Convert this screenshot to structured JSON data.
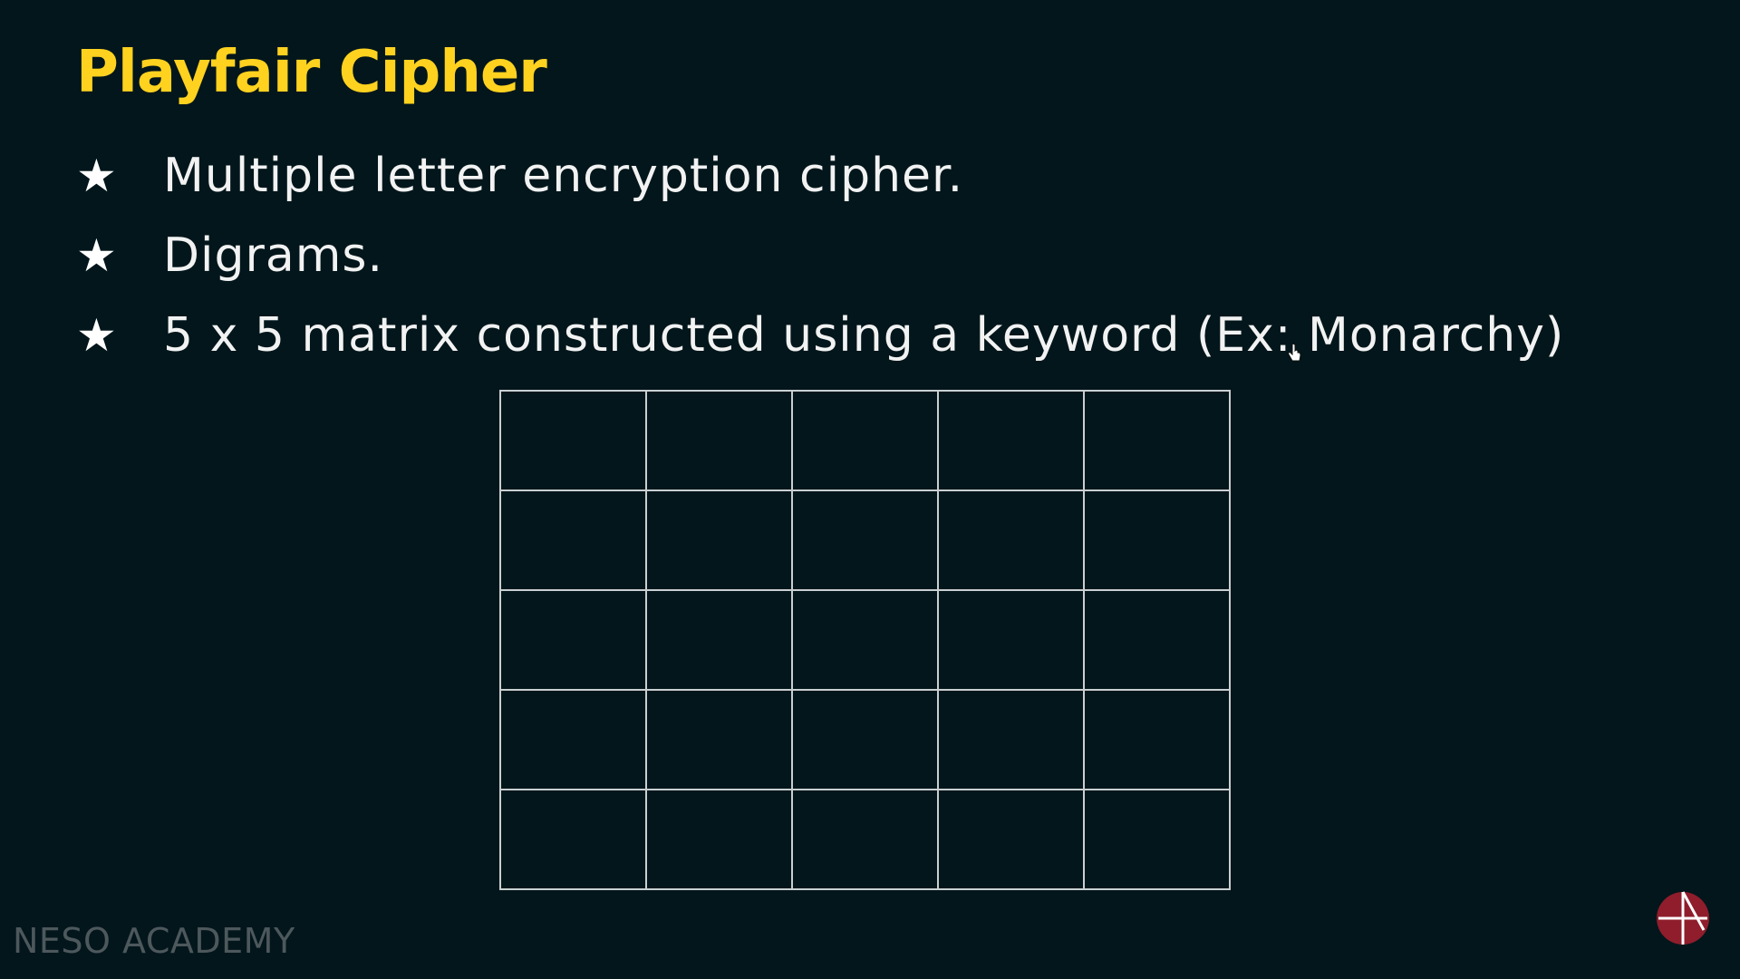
{
  "slide": {
    "title": "Playfair Cipher",
    "bullets": [
      {
        "icon": "star-icon",
        "text": "Multiple letter encryption cipher."
      },
      {
        "icon": "star-icon",
        "text": "Digrams."
      },
      {
        "icon": "star-icon",
        "text": "5 x 5 matrix constructed using a keyword (Ex: Monarchy)"
      }
    ],
    "matrix": {
      "rows": 5,
      "cols": 5,
      "cells": [
        [
          "",
          "",
          "",
          "",
          ""
        ],
        [
          "",
          "",
          "",
          "",
          ""
        ],
        [
          "",
          "",
          "",
          "",
          ""
        ],
        [
          "",
          "",
          "",
          "",
          ""
        ],
        [
          "",
          "",
          "",
          "",
          ""
        ]
      ]
    }
  },
  "watermark": {
    "text": "NESO ACADEMY"
  },
  "logo": {
    "icon": "neso-academy-logo-icon"
  },
  "colors": {
    "background": "#02161b",
    "title": "#ffd21f",
    "text": "#f2f2f2",
    "grid": "#c9cfd1",
    "watermark": "#5b6468",
    "logo": "#8f1d2c"
  }
}
